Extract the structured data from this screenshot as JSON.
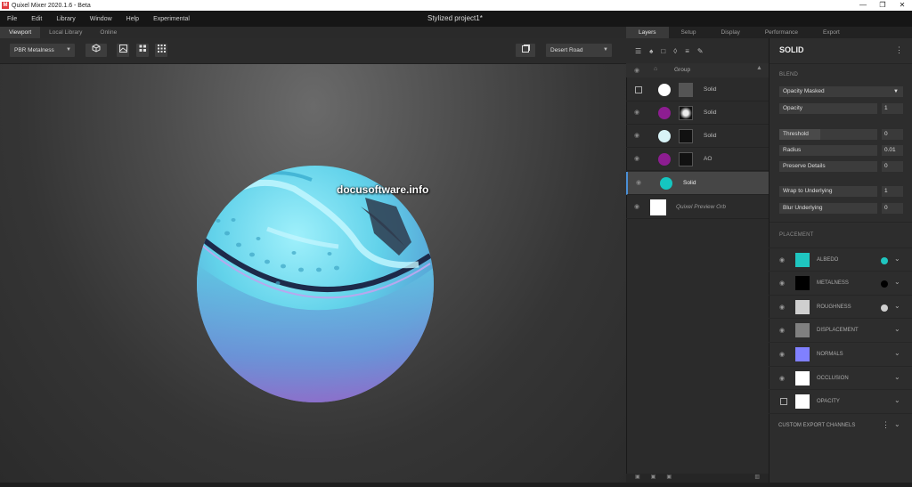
{
  "titlebar": {
    "app_title": "Quixel Mixer 2020.1.6 - Beta",
    "logo": "M",
    "min": "—",
    "max": "❐",
    "close": "✕"
  },
  "menu": {
    "items": [
      "File",
      "Edit",
      "Library",
      "Window",
      "Help",
      "Experimental"
    ],
    "project_title": "Stylized project1*"
  },
  "viewport_tabs": [
    "Viewport",
    "Local Library",
    "Online"
  ],
  "viewport_toolbar": {
    "shading_mode": "PBR Metalness",
    "environment": "Desert Road"
  },
  "watermark": "docusoftware.info",
  "right_tabs": [
    "Layers",
    "Setup",
    "Display",
    "Performance",
    "Export"
  ],
  "layers": {
    "group": {
      "label": "Group"
    },
    "items": [
      {
        "name": "Solid",
        "swatch": "#ffffff",
        "visible": false
      },
      {
        "name": "Solid",
        "swatch": "#8d1d91",
        "visible": true
      },
      {
        "name": "Solid",
        "swatch": "#d8f3f7",
        "visible": true
      },
      {
        "name": "AO",
        "swatch": "#8d1d91",
        "visible": true
      },
      {
        "name": "Solid",
        "swatch": "#15c6c0",
        "visible": true,
        "selected": true
      },
      {
        "name": "Quixel Preview Orb",
        "swatch": "#ffffff",
        "visible": true
      }
    ]
  },
  "properties": {
    "title": "SOLID",
    "blend_section": "BLEND",
    "blend_mode": "Opacity Masked",
    "opacity": {
      "label": "Opacity",
      "value": "1"
    },
    "threshold": {
      "label": "Threshold",
      "value": "0",
      "fill": 0.42
    },
    "radius": {
      "label": "Radius",
      "value": "0.01"
    },
    "preserve_details": {
      "label": "Preserve Details",
      "value": "0"
    },
    "wrap_to_underlying": {
      "label": "Wrap to Underlying",
      "value": "1"
    },
    "blur_underlying": {
      "label": "Blur Underlying",
      "value": "0"
    },
    "placement_section": "PLACEMENT",
    "channels": [
      {
        "name": "ALBEDO",
        "swatch": "#1fc6c0",
        "dot": "#1fc6c0"
      },
      {
        "name": "METALNESS",
        "swatch": "#000000",
        "dot": "#000000"
      },
      {
        "name": "ROUGHNESS",
        "swatch": "#cfcfcf",
        "dot": "#cfcfcf"
      },
      {
        "name": "DISPLACEMENT",
        "swatch": "#808080",
        "dot": ""
      },
      {
        "name": "NORMALS",
        "swatch": "#8080ff",
        "dot": ""
      },
      {
        "name": "OCCLUSION",
        "swatch": "#ffffff",
        "dot": ""
      },
      {
        "name": "OPACITY",
        "swatch": "#ffffff",
        "dot": ""
      }
    ],
    "custom_export": "CUSTOM EXPORT CHANNELS"
  }
}
